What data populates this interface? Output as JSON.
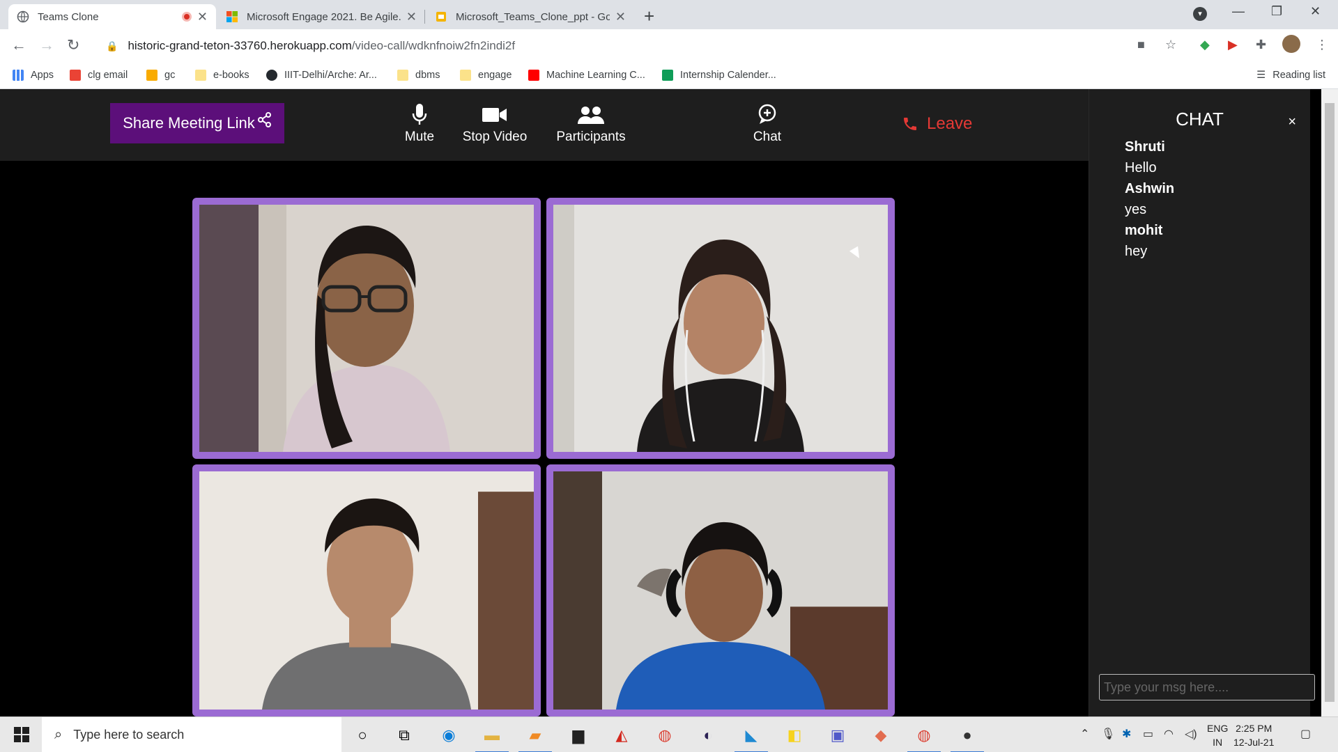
{
  "browser": {
    "tabs": [
      {
        "title": "Teams Clone",
        "active": true
      },
      {
        "title": "Microsoft Engage 2021. Be Agile."
      },
      {
        "title": "Microsoft_Teams_Clone_ppt - Go"
      }
    ],
    "url_host": "historic-grand-teton-33760.herokuapp.com",
    "url_path": "/video-call/wdknfnoiw2fn2indi2f",
    "bookmarks": [
      "Apps",
      "clg email",
      "gc",
      "e-books",
      "IIIT-Delhi/Arche: Ar...",
      "dbms",
      "engage",
      "Machine Learning C...",
      "Internship Calender..."
    ],
    "reading_list": "Reading list"
  },
  "toolbar": {
    "share_label": "Share Meeting Link",
    "mute_label": "Mute",
    "stop_video_label": "Stop Video",
    "participants_label": "Participants",
    "chat_label": "Chat",
    "leave_label": "Leave"
  },
  "chat": {
    "title": "CHAT",
    "close": "×",
    "messages": [
      {
        "sender": "Shruti",
        "text": "Hello"
      },
      {
        "sender": "Ashwin",
        "text": "yes"
      },
      {
        "sender": "mohit",
        "text": "hey"
      }
    ],
    "input_placeholder": "Type your msg here...."
  },
  "taskbar": {
    "search_placeholder": "Type here to search",
    "lang_top": "ENG",
    "lang_bottom": "IN",
    "time": "2:25 PM",
    "date": "12-Jul-21"
  },
  "colors": {
    "share_bg": "#5c0f7a",
    "tile_border": "#9b6bd3",
    "leave": "#e53935",
    "panel_bg": "#1e1e1e"
  }
}
